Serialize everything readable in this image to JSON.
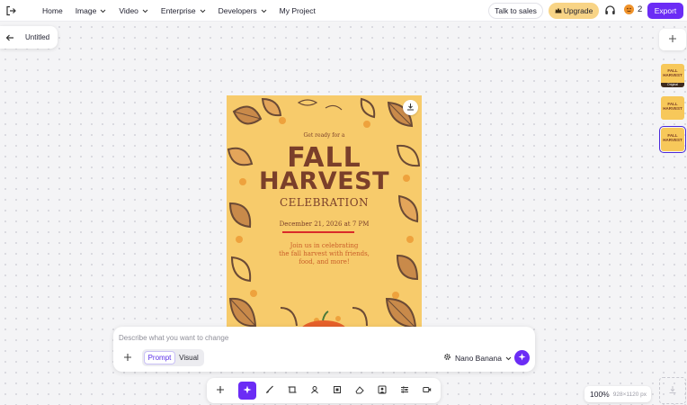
{
  "nav": {
    "items": [
      {
        "label": "Home",
        "has_menu": false
      },
      {
        "label": "Image",
        "has_menu": true
      },
      {
        "label": "Video",
        "has_menu": true
      },
      {
        "label": "Enterprise",
        "has_menu": true
      },
      {
        "label": "Developers",
        "has_menu": true
      },
      {
        "label": "My Project",
        "has_menu": false
      }
    ],
    "talk_to_sales": "Talk to sales",
    "upgrade": "Upgrade",
    "credits": "2",
    "export": "Export"
  },
  "document": {
    "title": "Untitled"
  },
  "thumbnails": [
    {
      "line1": "FALL",
      "line2": "HARVEST",
      "tag": "Original",
      "active": false
    },
    {
      "line1": "FALL",
      "line2": "HARVEST",
      "tag": "",
      "active": false
    },
    {
      "line1": "FALL",
      "line2": "HARVEST",
      "tag": "",
      "active": true
    }
  ],
  "poster": {
    "kicker": "Get ready for a",
    "title_line1": "FALL",
    "title_line2": "HARVEST",
    "subtitle": "CELEBRATION",
    "date": "December 21, 2026 at 7 PM",
    "body_line1": "Join us in celebrating",
    "body_line2": "the fall harvest with friends,",
    "body_line3": "food, and more!"
  },
  "prompt": {
    "placeholder": "Describe what you want to change",
    "value": "",
    "modes": [
      "Prompt",
      "Visual"
    ],
    "active_mode": "Prompt",
    "model": "Nano Banana"
  },
  "zoom": {
    "value": "100%",
    "dimensions": "928×1120 px"
  },
  "colors": {
    "accent": "#6b2cf5",
    "upgrade_bg": "#f8d486",
    "poster_bg": "#f7cb6b",
    "poster_text": "#7a3f2a"
  }
}
